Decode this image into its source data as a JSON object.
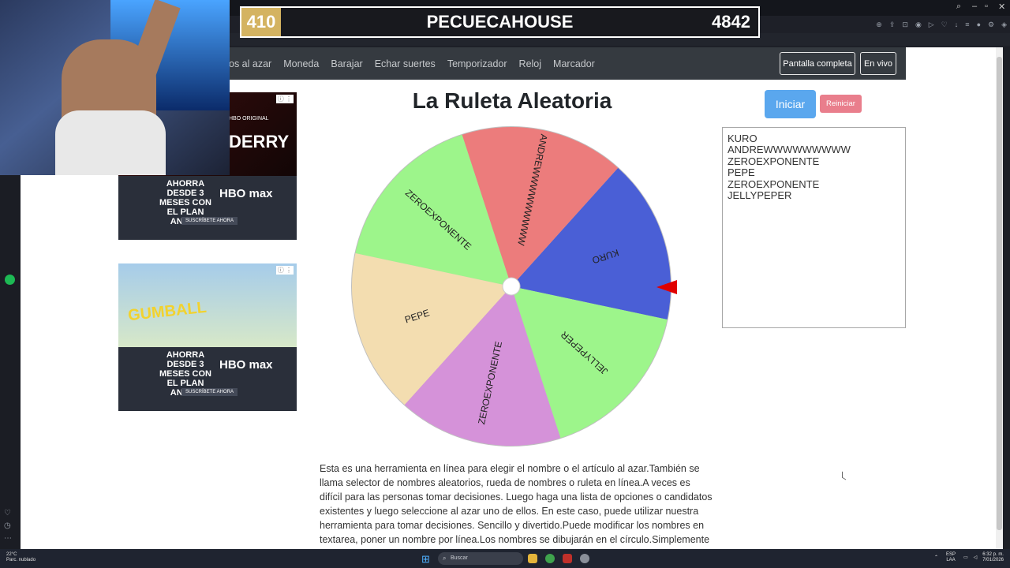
{
  "overlay": {
    "score_left": "410",
    "channel_name": "PECUECAHOUSE",
    "score_right": "4842"
  },
  "nav": {
    "links": [
      "os al azar",
      "Moneda",
      "Barajar",
      "Echar suertes",
      "Temporizador",
      "Reloj",
      "Marcador"
    ],
    "fullscreen_label": "Pantalla completa",
    "live_label": "En vivo"
  },
  "page": {
    "title": "La Ruleta Aleatoria",
    "start_label": "Iniciar",
    "reset_label": "Reiniciar",
    "names": [
      "KURO",
      "ANDREWWWWWWWWW",
      "ZEROEXPONENTE",
      "PEPE",
      "ZEROEXPONENTE",
      "JELLYPEPER"
    ],
    "description": "Esta es una herramienta en línea para elegir el nombre o el artículo al azar.También se llama selector de nombres aleatorios, rueda de nombres o ruleta en línea.A veces es difícil para las personas tomar decisiones. Luego haga una lista de opciones o candidatos existentes y luego seleccione al azar uno de ellos. En este caso, puede utilizar nuestra herramienta para tomar decisiones. Sencillo y divertido.Puede modificar los nombres en textarea, poner un nombre por línea.Los nombres se dibujarán en el círculo.Simplemente haga clic en la rueda"
  },
  "wheel": {
    "segments": [
      {
        "label": "KURO",
        "color": "#4a5fd6"
      },
      {
        "label": "ANDREWWWWWWWWW",
        "color": "#ec7c7c"
      },
      {
        "label": "ZEROEXPONENTE",
        "color": "#9df58b"
      },
      {
        "label": "PEPE",
        "color": "#f3ddb0"
      },
      {
        "label": "ZEROEXPONENTE",
        "color": "#d592d9"
      },
      {
        "label": "JELLYPEPER",
        "color": "#9df58b"
      }
    ],
    "pointer_color": "#e00000"
  },
  "ads": {
    "ad1": {
      "brand": "HBO ORIGINAL",
      "headline": "DERRY",
      "offer": "AHORRA DESDE 3 MESES CON EL PLAN ANUAL",
      "logo": "HBO max",
      "cta": "SUSCRÍBETE AHORA"
    },
    "ad2": {
      "brand": "CN",
      "headline": "GUMBALL",
      "offer": "AHORRA DESDE 3 MESES CON EL PLAN ANUAL",
      "logo": "HBO max",
      "cta": "SUSCRÍBETE AHORA"
    }
  },
  "taskbar": {
    "weather_temp": "22°C",
    "weather_desc": "Parc. nublado",
    "search_placeholder": "Buscar",
    "lang": "ESP LAA",
    "time": "6:32 p. m.",
    "date": "7/01/2026"
  }
}
